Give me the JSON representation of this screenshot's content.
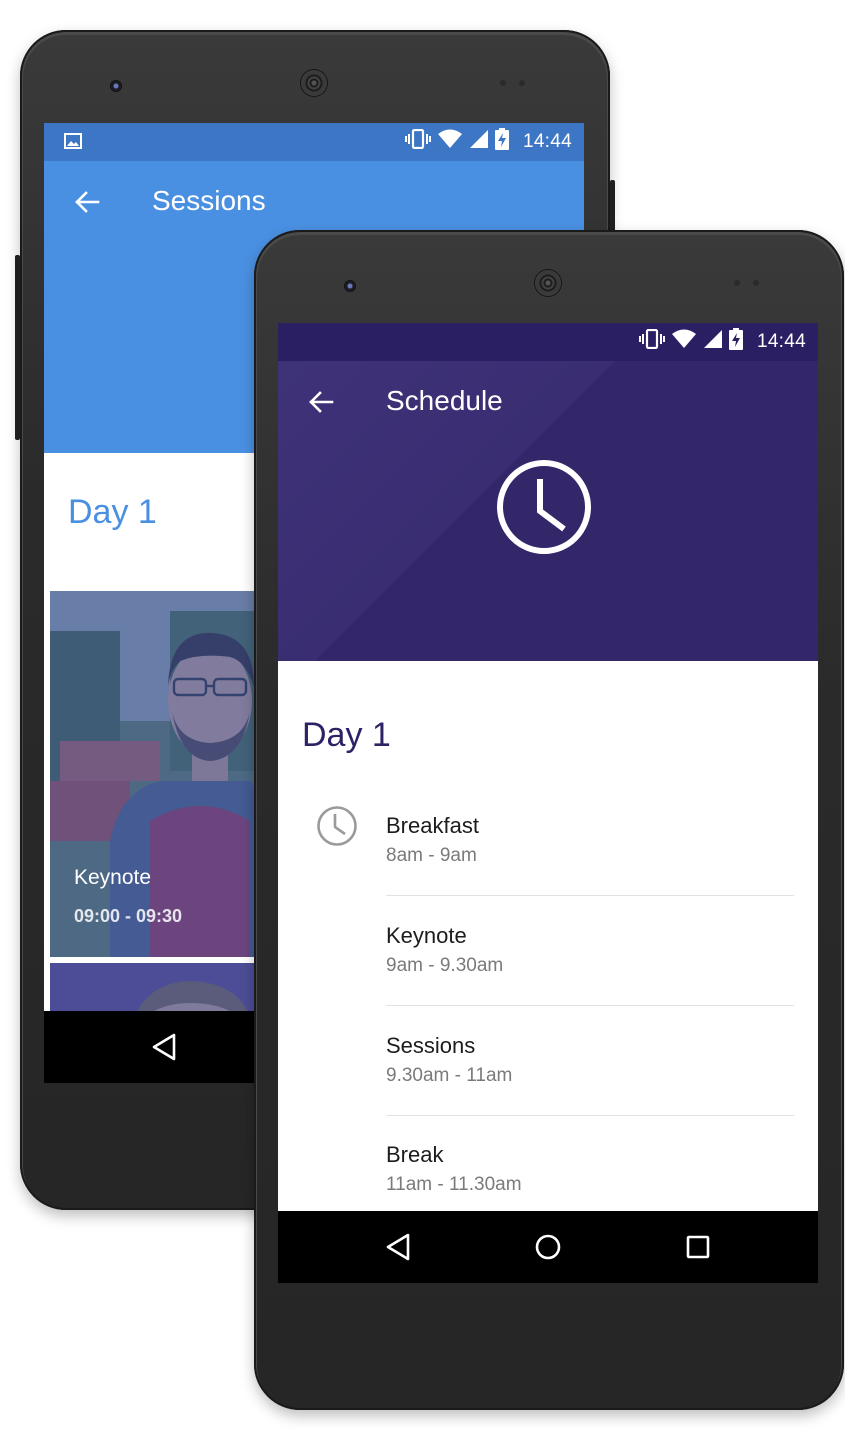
{
  "back_app": {
    "status": {
      "time": "14:44"
    },
    "toolbar": {
      "title": "Sessions"
    },
    "day_heading": "Day 1",
    "cards": [
      {
        "title": "Keynote",
        "time": "09:00 - 09:30"
      }
    ],
    "colors": {
      "status_bar": "#3d76c4",
      "primary": "#4a90e2"
    }
  },
  "front_app": {
    "status": {
      "time": "14:44"
    },
    "toolbar": {
      "title": "Schedule"
    },
    "header_icon": "clock-icon",
    "day_heading": "Day 1",
    "schedule": [
      {
        "title": "Breakfast",
        "time": "8am - 9am"
      },
      {
        "title": "Keynote",
        "time": "9am - 9.30am"
      },
      {
        "title": "Sessions",
        "time": "9.30am - 11am"
      },
      {
        "title": "Break",
        "time": "11am - 11.30am"
      }
    ],
    "colors": {
      "status_bar": "#2b1f63",
      "primary": "#36296e",
      "heading": "#2e2266"
    }
  },
  "icons": {
    "back": "arrow-back-icon",
    "vibrate": "vibrate-icon",
    "wifi": "wifi-icon",
    "signal": "cellular-signal-icon",
    "battery": "battery-charging-icon",
    "gallery": "image-notification-icon",
    "nav_back": "nav-back-icon",
    "nav_home": "nav-home-icon",
    "nav_recents": "nav-recents-icon",
    "schedule_item": "clock-icon"
  }
}
